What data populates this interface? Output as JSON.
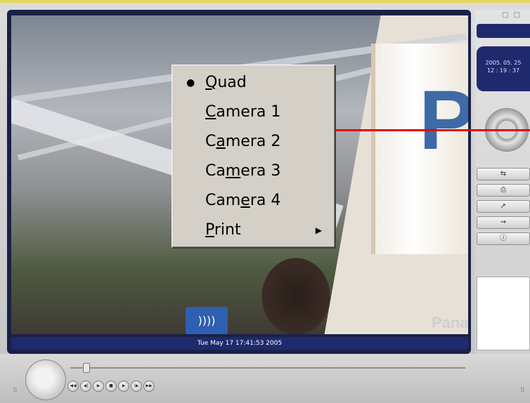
{
  "video": {
    "timestamp": "Tue May 17 17:41:53 2005",
    "banner_letter": "P",
    "banner_logo": "Pana",
    "sign_text": "))))"
  },
  "side_panel": {
    "top_icons": "□ □",
    "clock_date": "2005. 05. 25",
    "clock_time": "12 : 19 : 37",
    "buttons": [
      {
        "icon_name": "swap-icon",
        "glyph": "⇆"
      },
      {
        "icon_name": "printer-icon",
        "glyph": "⎙"
      },
      {
        "icon_name": "export-icon",
        "glyph": "➚"
      },
      {
        "icon_name": "network-icon",
        "glyph": "⇝"
      },
      {
        "icon_name": "info-icon",
        "glyph": "ⓘ"
      }
    ]
  },
  "controls": {
    "grip_left": "⠿",
    "grip_right": "⠿",
    "transport": [
      "◀◀",
      "◀|",
      "▶",
      "■",
      "▶",
      "|▶",
      "▶▶"
    ]
  },
  "context_menu": {
    "items": [
      {
        "pre": "",
        "key": "Q",
        "post": "uad",
        "checked": true,
        "submenu": false
      },
      {
        "pre": "",
        "key": "C",
        "post": "amera 1",
        "checked": false,
        "submenu": false
      },
      {
        "pre": "C",
        "key": "a",
        "post": "mera 2",
        "checked": false,
        "submenu": false
      },
      {
        "pre": "Ca",
        "key": "m",
        "post": "era 3",
        "checked": false,
        "submenu": false
      },
      {
        "pre": "Cam",
        "key": "e",
        "post": "ra 4",
        "checked": false,
        "submenu": false
      },
      {
        "pre": "",
        "key": "P",
        "post": "rint",
        "checked": false,
        "submenu": true
      }
    ],
    "check_glyph": "●",
    "submenu_glyph": "▶"
  },
  "colors": {
    "accent_bar": "#1f2a6e",
    "connector": "#e80000",
    "menu_bg": "#d4d0c8"
  }
}
